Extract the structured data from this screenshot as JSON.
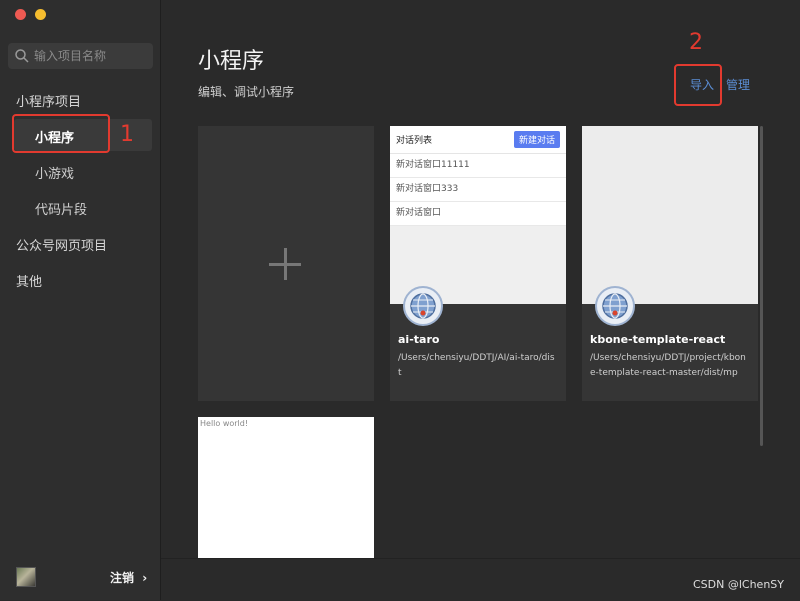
{
  "window": {
    "controls": [
      "close",
      "minimize"
    ]
  },
  "sidebar": {
    "search": {
      "placeholder": "输入项目名称",
      "value": ""
    },
    "sections": [
      {
        "label": "小程序项目",
        "children": [
          "小程序",
          "小游戏",
          "代码片段"
        ]
      },
      {
        "label": "公众号网页项目"
      },
      {
        "label": "其他"
      }
    ],
    "selected": "小程序",
    "footer": {
      "logout_label": "注销",
      "chevron": "›"
    }
  },
  "main": {
    "title": "小程序",
    "subtitle": "编辑、调试小程序",
    "actions": {
      "import_label": "导入",
      "manage_label": "管理"
    },
    "new_project_icon": "plus-icon",
    "projects": [
      {
        "name": "ai-taro",
        "path": "/Users/chensiyu/DDTJ/AI/ai-taro/dist",
        "thumbnail": {
          "title": "对话列表",
          "button": "新建对话",
          "rows": [
            "新对话窗口11111",
            "新对话窗口333",
            "新对话窗口"
          ]
        }
      },
      {
        "name": "kbone-template-react",
        "path": "/Users/chensiyu/DDTJ/project/kbone-template-react-master/dist/mp"
      },
      {
        "thumbnail_text": "Hello world!"
      }
    ]
  },
  "annotations": {
    "one": "1",
    "two": "2"
  },
  "watermark": "CSDN @lChenSY",
  "colors": {
    "accent_link": "#5b8ed6",
    "annotation_red": "#e23a2f"
  }
}
